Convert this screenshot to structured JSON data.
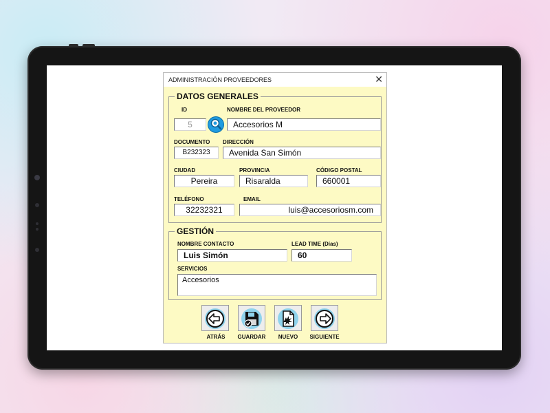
{
  "window": {
    "title": "ADMINISTRACIÓN PROVEEDORES",
    "close": "✕"
  },
  "datos_generales": {
    "legend": "DATOS GENERALES",
    "id_label": "ID",
    "id_value": "5",
    "nombre_label": "NOMBRE DEL PROVEEDOR",
    "nombre_value": "Accesorios M",
    "documento_label": "DOCUMENTO",
    "documento_value": "B232323",
    "direccion_label": "DIRECCIÓN",
    "direccion_value": "Avenida San Simón",
    "ciudad_label": "CIUDAD",
    "ciudad_value": "Pereira",
    "provincia_label": "PROVINCIA",
    "provincia_value": "Risaralda",
    "cp_label": "CÓDIGO POSTAL",
    "cp_value": "660001",
    "telefono_label": "TELÉFONO",
    "telefono_value": "32232321",
    "email_label": "EMAIL",
    "email_value": "luis@accesoriosm.com"
  },
  "gestion": {
    "legend": "GESTIÓN",
    "contacto_label": "NOMBRE CONTACTO",
    "contacto_value": "Luis Simón",
    "leadtime_label": "LEAD TIME (Días)",
    "leadtime_value": "60",
    "servicios_label": "SERVICIOS",
    "servicios_value": "Accesorios"
  },
  "buttons": {
    "atras": "ATRÁS",
    "guardar": "GUARDAR",
    "nuevo": "NUEVO",
    "siguiente": "SIGUIENTE"
  },
  "icons": {
    "search": "search-icon",
    "atras": "arrow-left-icon",
    "guardar": "floppy-disk-icon",
    "nuevo": "new-document-icon",
    "siguiente": "arrow-right-icon"
  },
  "colors": {
    "dialog_bg": "#fdfac4",
    "search_button": "#1f9be0",
    "tablet_frame": "#151515"
  }
}
